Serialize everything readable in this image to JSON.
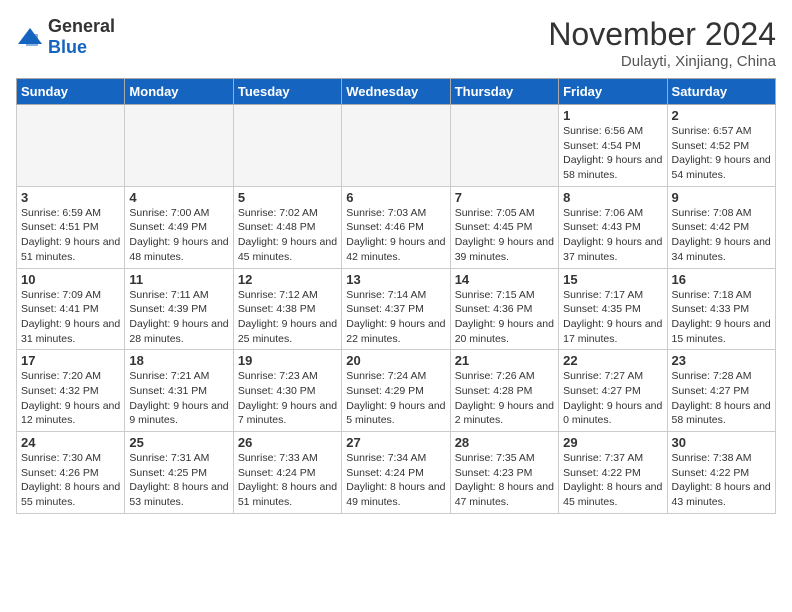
{
  "logo": {
    "general": "General",
    "blue": "Blue"
  },
  "header": {
    "month": "November 2024",
    "location": "Dulayti, Xinjiang, China"
  },
  "weekdays": [
    "Sunday",
    "Monday",
    "Tuesday",
    "Wednesday",
    "Thursday",
    "Friday",
    "Saturday"
  ],
  "weeks": [
    [
      {
        "day": "",
        "info": ""
      },
      {
        "day": "",
        "info": ""
      },
      {
        "day": "",
        "info": ""
      },
      {
        "day": "",
        "info": ""
      },
      {
        "day": "",
        "info": ""
      },
      {
        "day": "1",
        "info": "Sunrise: 6:56 AM\nSunset: 4:54 PM\nDaylight: 9 hours and 58 minutes."
      },
      {
        "day": "2",
        "info": "Sunrise: 6:57 AM\nSunset: 4:52 PM\nDaylight: 9 hours and 54 minutes."
      }
    ],
    [
      {
        "day": "3",
        "info": "Sunrise: 6:59 AM\nSunset: 4:51 PM\nDaylight: 9 hours and 51 minutes."
      },
      {
        "day": "4",
        "info": "Sunrise: 7:00 AM\nSunset: 4:49 PM\nDaylight: 9 hours and 48 minutes."
      },
      {
        "day": "5",
        "info": "Sunrise: 7:02 AM\nSunset: 4:48 PM\nDaylight: 9 hours and 45 minutes."
      },
      {
        "day": "6",
        "info": "Sunrise: 7:03 AM\nSunset: 4:46 PM\nDaylight: 9 hours and 42 minutes."
      },
      {
        "day": "7",
        "info": "Sunrise: 7:05 AM\nSunset: 4:45 PM\nDaylight: 9 hours and 39 minutes."
      },
      {
        "day": "8",
        "info": "Sunrise: 7:06 AM\nSunset: 4:43 PM\nDaylight: 9 hours and 37 minutes."
      },
      {
        "day": "9",
        "info": "Sunrise: 7:08 AM\nSunset: 4:42 PM\nDaylight: 9 hours and 34 minutes."
      }
    ],
    [
      {
        "day": "10",
        "info": "Sunrise: 7:09 AM\nSunset: 4:41 PM\nDaylight: 9 hours and 31 minutes."
      },
      {
        "day": "11",
        "info": "Sunrise: 7:11 AM\nSunset: 4:39 PM\nDaylight: 9 hours and 28 minutes."
      },
      {
        "day": "12",
        "info": "Sunrise: 7:12 AM\nSunset: 4:38 PM\nDaylight: 9 hours and 25 minutes."
      },
      {
        "day": "13",
        "info": "Sunrise: 7:14 AM\nSunset: 4:37 PM\nDaylight: 9 hours and 22 minutes."
      },
      {
        "day": "14",
        "info": "Sunrise: 7:15 AM\nSunset: 4:36 PM\nDaylight: 9 hours and 20 minutes."
      },
      {
        "day": "15",
        "info": "Sunrise: 7:17 AM\nSunset: 4:35 PM\nDaylight: 9 hours and 17 minutes."
      },
      {
        "day": "16",
        "info": "Sunrise: 7:18 AM\nSunset: 4:33 PM\nDaylight: 9 hours and 15 minutes."
      }
    ],
    [
      {
        "day": "17",
        "info": "Sunrise: 7:20 AM\nSunset: 4:32 PM\nDaylight: 9 hours and 12 minutes."
      },
      {
        "day": "18",
        "info": "Sunrise: 7:21 AM\nSunset: 4:31 PM\nDaylight: 9 hours and 9 minutes."
      },
      {
        "day": "19",
        "info": "Sunrise: 7:23 AM\nSunset: 4:30 PM\nDaylight: 9 hours and 7 minutes."
      },
      {
        "day": "20",
        "info": "Sunrise: 7:24 AM\nSunset: 4:29 PM\nDaylight: 9 hours and 5 minutes."
      },
      {
        "day": "21",
        "info": "Sunrise: 7:26 AM\nSunset: 4:28 PM\nDaylight: 9 hours and 2 minutes."
      },
      {
        "day": "22",
        "info": "Sunrise: 7:27 AM\nSunset: 4:27 PM\nDaylight: 9 hours and 0 minutes."
      },
      {
        "day": "23",
        "info": "Sunrise: 7:28 AM\nSunset: 4:27 PM\nDaylight: 8 hours and 58 minutes."
      }
    ],
    [
      {
        "day": "24",
        "info": "Sunrise: 7:30 AM\nSunset: 4:26 PM\nDaylight: 8 hours and 55 minutes."
      },
      {
        "day": "25",
        "info": "Sunrise: 7:31 AM\nSunset: 4:25 PM\nDaylight: 8 hours and 53 minutes."
      },
      {
        "day": "26",
        "info": "Sunrise: 7:33 AM\nSunset: 4:24 PM\nDaylight: 8 hours and 51 minutes."
      },
      {
        "day": "27",
        "info": "Sunrise: 7:34 AM\nSunset: 4:24 PM\nDaylight: 8 hours and 49 minutes."
      },
      {
        "day": "28",
        "info": "Sunrise: 7:35 AM\nSunset: 4:23 PM\nDaylight: 8 hours and 47 minutes."
      },
      {
        "day": "29",
        "info": "Sunrise: 7:37 AM\nSunset: 4:22 PM\nDaylight: 8 hours and 45 minutes."
      },
      {
        "day": "30",
        "info": "Sunrise: 7:38 AM\nSunset: 4:22 PM\nDaylight: 8 hours and 43 minutes."
      }
    ]
  ]
}
